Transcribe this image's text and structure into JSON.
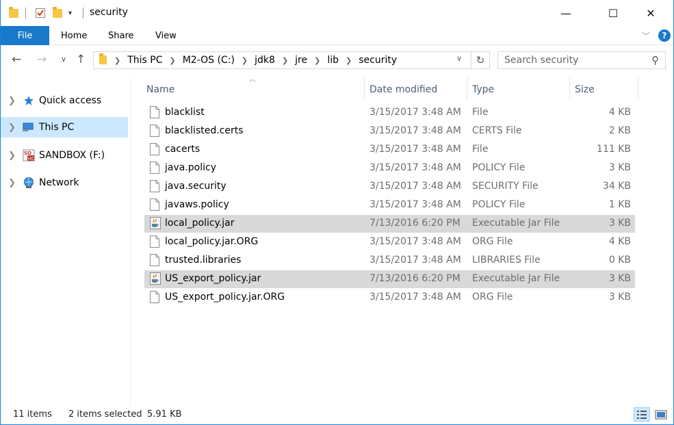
{
  "window": {
    "title": "security",
    "minimize": "—",
    "maximize": "☐",
    "close": "✕"
  },
  "ribbon": {
    "tabs": [
      "File",
      "Home",
      "Share",
      "View"
    ],
    "help": "?",
    "accent": "#1979ca"
  },
  "address": {
    "crumbs": [
      "This PC",
      "M2-OS (C:)",
      "jdk8",
      "jre",
      "lib",
      "security"
    ]
  },
  "search": {
    "placeholder": "Search security"
  },
  "nav_pane": {
    "items": [
      {
        "label": "Quick access",
        "icon": "star-icon",
        "selected": false
      },
      {
        "label": "This PC",
        "icon": "computer-icon",
        "selected": true
      },
      {
        "label": "SANDBOX (F:)",
        "icon": "sd-card-icon",
        "selected": false
      },
      {
        "label": "Network",
        "icon": "network-icon",
        "selected": false
      }
    ]
  },
  "columns": {
    "name": "Name",
    "date": "Date modified",
    "type": "Type",
    "size": "Size"
  },
  "files": [
    {
      "name": "blacklist",
      "date": "3/15/2017 3:48 AM",
      "type": "File",
      "size": "4 KB",
      "icon": "file-icon",
      "selected": false
    },
    {
      "name": "blacklisted.certs",
      "date": "3/15/2017 3:48 AM",
      "type": "CERTS File",
      "size": "2 KB",
      "icon": "file-icon",
      "selected": false
    },
    {
      "name": "cacerts",
      "date": "3/15/2017 3:48 AM",
      "type": "File",
      "size": "111 KB",
      "icon": "file-icon",
      "selected": false
    },
    {
      "name": "java.policy",
      "date": "3/15/2017 3:48 AM",
      "type": "POLICY File",
      "size": "3 KB",
      "icon": "file-icon",
      "selected": false
    },
    {
      "name": "java.security",
      "date": "3/15/2017 3:48 AM",
      "type": "SECURITY File",
      "size": "34 KB",
      "icon": "file-icon",
      "selected": false
    },
    {
      "name": "javaws.policy",
      "date": "3/15/2017 3:48 AM",
      "type": "POLICY File",
      "size": "1 KB",
      "icon": "file-icon",
      "selected": false
    },
    {
      "name": "local_policy.jar",
      "date": "7/13/2016 6:20 PM",
      "type": "Executable Jar File",
      "size": "3 KB",
      "icon": "jar-icon",
      "selected": true
    },
    {
      "name": "local_policy.jar.ORG",
      "date": "3/15/2017 3:48 AM",
      "type": "ORG File",
      "size": "4 KB",
      "icon": "file-icon",
      "selected": false
    },
    {
      "name": "trusted.libraries",
      "date": "3/15/2017 3:48 AM",
      "type": "LIBRARIES File",
      "size": "0 KB",
      "icon": "file-icon",
      "selected": false
    },
    {
      "name": "US_export_policy.jar",
      "date": "7/13/2016 6:20 PM",
      "type": "Executable Jar File",
      "size": "3 KB",
      "icon": "jar-icon",
      "selected": true
    },
    {
      "name": "US_export_policy.jar.ORG",
      "date": "3/15/2017 3:48 AM",
      "type": "ORG File",
      "size": "3 KB",
      "icon": "file-icon",
      "selected": false
    }
  ],
  "status": {
    "count": "11 items",
    "selected": "2 items selected",
    "size": "5.91 KB"
  }
}
